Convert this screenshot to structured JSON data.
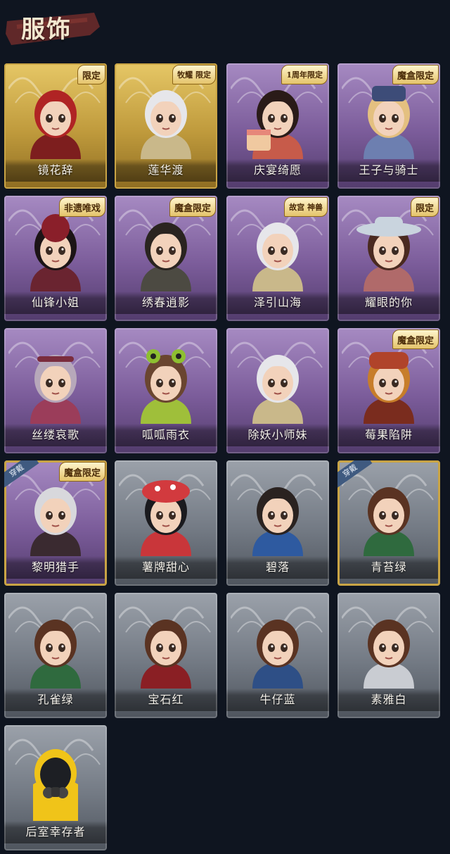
{
  "header": {
    "title": "服饰"
  },
  "colors": {
    "gold": "#c9a445",
    "purple": "#8a6aa6",
    "gray": "#8a9099",
    "background": "#0f1520",
    "worn_tag": "#3f5a80"
  },
  "cards": [
    {
      "name": "镜花辞",
      "badge": "限定",
      "tier": "gold",
      "worn": false,
      "icon": "red-veil-character-icon"
    },
    {
      "name": "莲华渡",
      "badge": "牧耀 限定",
      "tier": "gold",
      "worn": false,
      "icon": "white-hair-character-icon"
    },
    {
      "name": "庆宴绮愿",
      "badge": "1周年限定",
      "tier": "purple",
      "worn": false,
      "icon": "cake-character-icon"
    },
    {
      "name": "王子与骑士",
      "badge": "魔盒限定",
      "tier": "purple",
      "worn": false,
      "icon": "prince-hat-character-icon"
    },
    {
      "name": "仙锋小姐",
      "badge": "非遗唯戏",
      "tier": "purple",
      "worn": false,
      "icon": "opera-headdress-character-icon"
    },
    {
      "name": "绣春逍影",
      "badge": "魔盒限定",
      "tier": "purple",
      "worn": false,
      "icon": "swordsman-character-icon"
    },
    {
      "name": "泽引山海",
      "badge": "故宫 神兽",
      "tier": "purple",
      "worn": false,
      "icon": "silver-hair-character-icon"
    },
    {
      "name": "耀眼的你",
      "badge": "限定",
      "tier": "purple",
      "worn": false,
      "icon": "cowboy-hat-character-icon"
    },
    {
      "name": "丝缕哀歌",
      "badge": "",
      "tier": "purple",
      "worn": false,
      "icon": "doll-character-icon"
    },
    {
      "name": "呱呱雨衣",
      "badge": "",
      "tier": "purple",
      "worn": false,
      "icon": "frog-hat-character-icon"
    },
    {
      "name": "除妖小师妹",
      "badge": "",
      "tier": "purple",
      "worn": false,
      "icon": "blindfold-character-icon"
    },
    {
      "name": "莓果陷阱",
      "badge": "魔盒限定",
      "tier": "purple",
      "worn": false,
      "icon": "berry-hat-character-icon"
    },
    {
      "name": "黎明猎手",
      "badge": "魔盒限定",
      "tier": "purple",
      "worn": true,
      "worn_label": "穿戴",
      "icon": "hunter-character-icon"
    },
    {
      "name": "薯牌甜心",
      "badge": "",
      "tier": "gray",
      "worn": false,
      "icon": "mushroom-hat-character-icon"
    },
    {
      "name": "碧落",
      "badge": "",
      "tier": "gray",
      "worn": false,
      "icon": "braid-character-icon"
    },
    {
      "name": "青苔绿",
      "badge": "",
      "tier": "gray",
      "worn": true,
      "worn_label": "穿戴",
      "icon": "girl-green-character-icon"
    },
    {
      "name": "孔雀绿",
      "badge": "",
      "tier": "gray",
      "worn": false,
      "icon": "girl-teal-character-icon"
    },
    {
      "name": "宝石红",
      "badge": "",
      "tier": "gray",
      "worn": false,
      "icon": "girl-red-character-icon"
    },
    {
      "name": "牛仔蓝",
      "badge": "",
      "tier": "gray",
      "worn": false,
      "icon": "girl-blue-character-icon"
    },
    {
      "name": "素雅白",
      "badge": "",
      "tier": "gray",
      "worn": false,
      "icon": "girl-white-character-icon"
    },
    {
      "name": "后室幸存者",
      "badge": "",
      "tier": "gray",
      "worn": false,
      "icon": "gas-mask-character-icon"
    }
  ]
}
